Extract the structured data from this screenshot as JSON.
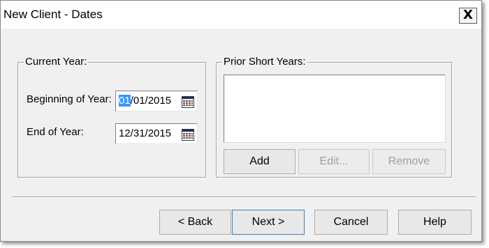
{
  "window": {
    "title": "New Client - Dates",
    "close_label": "X"
  },
  "current_year": {
    "legend": "Current Year:",
    "beginning_label": "Beginning of Year:",
    "beginning_value_selected": "01",
    "beginning_value_rest": "/01/2015",
    "end_label": "End of Year:",
    "end_value": "12/31/2015",
    "calendar_icon": "calendar-icon"
  },
  "prior_short_years": {
    "legend": "Prior Short Years:",
    "items": [],
    "add_label": "Add",
    "edit_label": "Edit...",
    "remove_label": "Remove"
  },
  "footer": {
    "back_label": "< Back",
    "next_label": "Next >",
    "cancel_label": "Cancel",
    "help_label": "Help"
  },
  "colors": {
    "dialog_bg": "#f0f0f0",
    "selection": "#3399ff",
    "default_button_border": "#3c7fb1"
  }
}
